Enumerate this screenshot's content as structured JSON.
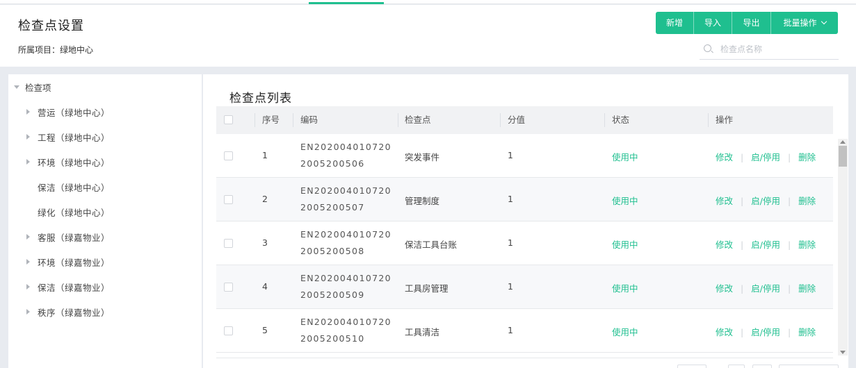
{
  "header": {
    "title": "检查点设置",
    "project_label": "所属项目：绿地中心"
  },
  "toolbar": {
    "add_label": "新增",
    "import_label": "导入",
    "export_label": "导出",
    "batch_label": "批量操作"
  },
  "search": {
    "placeholder": "检查点名称"
  },
  "tree": {
    "root_label": "检查项",
    "items": [
      {
        "label": "营运（绿地中心）",
        "expandable": true
      },
      {
        "label": "工程（绿地中心）",
        "expandable": true
      },
      {
        "label": "环境（绿地中心）",
        "expandable": true
      },
      {
        "label": "保洁（绿地中心）",
        "expandable": false
      },
      {
        "label": "绿化（绿地中心）",
        "expandable": false
      },
      {
        "label": "客服（绿嘉物业）",
        "expandable": true
      },
      {
        "label": "环境（绿嘉物业）",
        "expandable": true
      },
      {
        "label": "保洁（绿嘉物业）",
        "expandable": true
      },
      {
        "label": "秩序（绿嘉物业）",
        "expandable": true
      }
    ]
  },
  "list": {
    "title": "检查点列表",
    "columns": [
      "序号",
      "编码",
      "检查点",
      "分值",
      "状态",
      "操作"
    ],
    "rows": [
      {
        "index": "1",
        "code_line1": "EN202004010720",
        "code_line2": "2005200506",
        "name": "突发事件",
        "score": "1",
        "status": "使用中"
      },
      {
        "index": "2",
        "code_line1": "EN202004010720",
        "code_line2": "2005200507",
        "name": "管理制度",
        "score": "1",
        "status": "使用中"
      },
      {
        "index": "3",
        "code_line1": "EN202004010720",
        "code_line2": "2005200508",
        "name": "保洁工具台账",
        "score": "1",
        "status": "使用中"
      },
      {
        "index": "4",
        "code_line1": "EN202004010720",
        "code_line2": "2005200509",
        "name": "工具房管理",
        "score": "1",
        "status": "使用中"
      },
      {
        "index": "5",
        "code_line1": "EN202004010720",
        "code_line2": "2005200510",
        "name": "工具清洁",
        "score": "1",
        "status": "使用中"
      }
    ],
    "actions": {
      "edit": "修改",
      "toggle": "启/停用",
      "delete": "删除"
    }
  },
  "colors": {
    "accent": "#1fbf8f",
    "background": "#e8ebf0",
    "header_row": "#f1f2f4"
  }
}
